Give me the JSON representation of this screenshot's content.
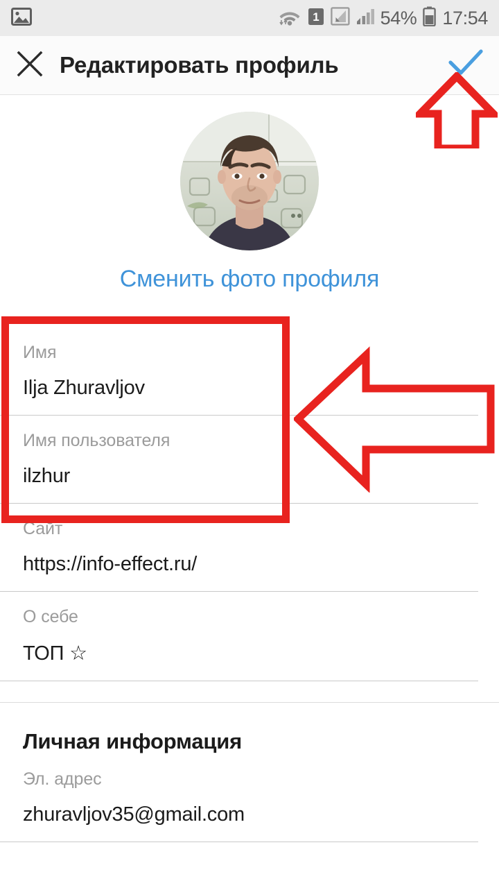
{
  "status_bar": {
    "left_icons": [
      "image-screenshot-icon"
    ],
    "right_icons": [
      "wifi-icon",
      "sim-1-icon",
      "signal-no-service-icon",
      "signal-bars-icon",
      "battery-icon"
    ],
    "battery_percent": "54%",
    "time": "17:54"
  },
  "app_bar": {
    "close_icon": "close-icon",
    "title": "Редактировать профиль",
    "done_icon": "check-icon",
    "done_color": "#4a9fe0"
  },
  "profile": {
    "avatar_alt": "profile-photo",
    "change_photo_label": "Сменить фото профиля",
    "change_photo_color": "#3f93d9"
  },
  "form": {
    "fields": [
      {
        "label": "Имя",
        "value": "Ilja  Zhuravljov",
        "name": "name-field"
      },
      {
        "label": "Имя пользователя",
        "value": "ilzhur",
        "name": "username-field"
      },
      {
        "label": "Сайт",
        "value": "https://info-effect.ru/",
        "name": "website-field"
      },
      {
        "label": "О себе",
        "value": "ТОП ☆",
        "name": "bio-field"
      }
    ]
  },
  "personal_section": {
    "title": "Личная информация",
    "fields": [
      {
        "label": "Эл. адрес",
        "value": "zhuravljov35@gmail.com",
        "name": "email-field"
      }
    ]
  },
  "annotations": {
    "color": "#e8231f",
    "rectangle_name": "highlight-rectangle-name-username",
    "arrow_up_name": "arrow-up-to-done-check",
    "arrow_left_name": "arrow-left-to-name-fields"
  }
}
